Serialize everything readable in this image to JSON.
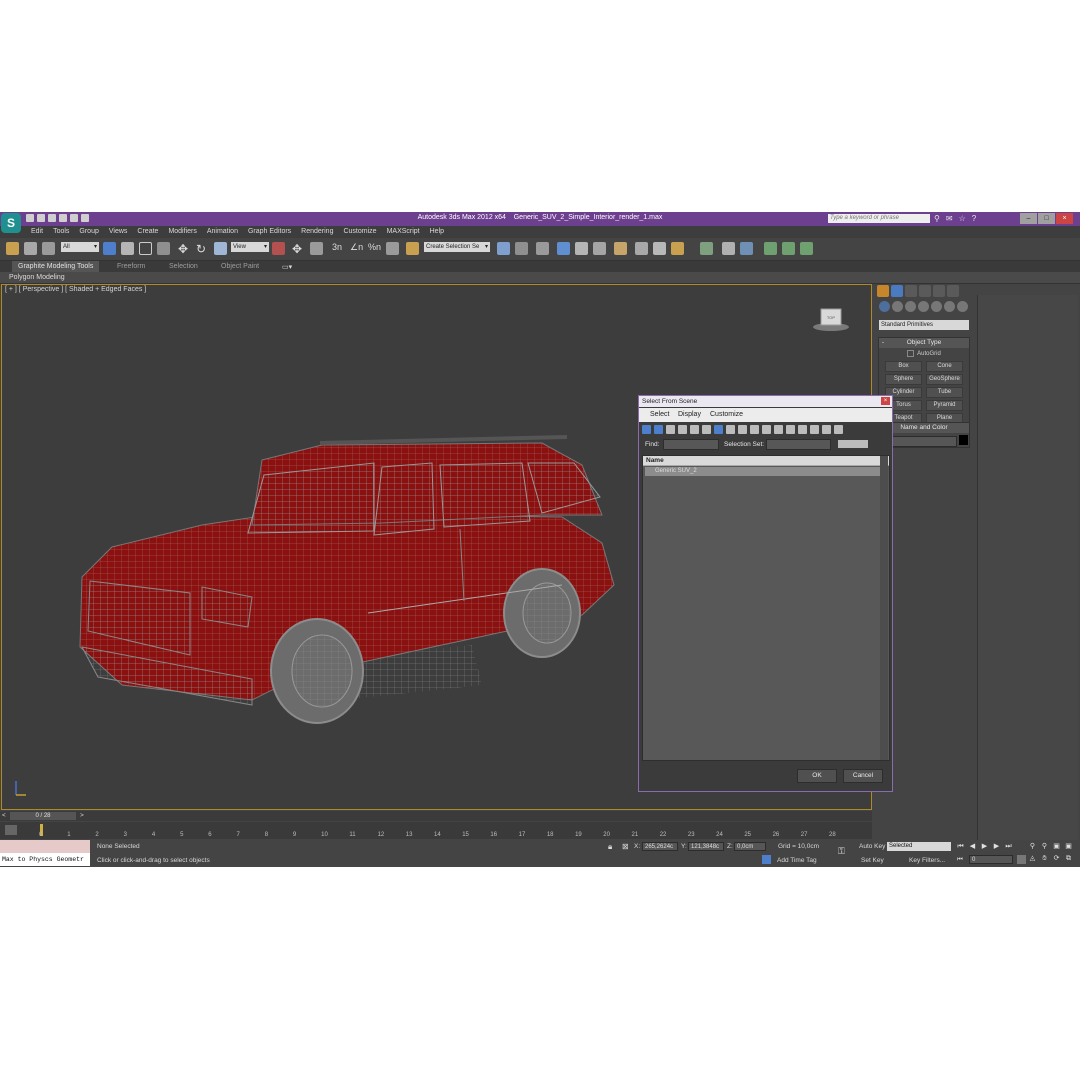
{
  "window": {
    "app_title": "Autodesk 3ds Max  2012 x64",
    "file_title": "Generic_SUV_2_Simple_Interior_render_1.max",
    "search_placeholder": "Type a keyword or phrase",
    "title_bar_color": "#6d3f8f"
  },
  "menu": [
    "Edit",
    "Tools",
    "Group",
    "Views",
    "Create",
    "Modifiers",
    "Animation",
    "Graph Editors",
    "Rendering",
    "Customize",
    "MAXScript",
    "Help"
  ],
  "toolbar": {
    "selection_filter": "All",
    "ref_coord": "View",
    "named_selection": "Create Selection Se"
  },
  "ribbon": {
    "tabs": [
      "Graphite Modeling Tools",
      "Freeform",
      "Selection",
      "Object Paint"
    ],
    "panel": "Polygon Modeling"
  },
  "viewport": {
    "label": "[ + ] [ Perspective ] [ Shaded + Edged Faces ]",
    "border_color": "#b08a25",
    "body_color": "#8b1111"
  },
  "command_panel": {
    "category": "Standard Primitives",
    "object_type_title": "Object Type",
    "autogrid": "AutoGrid",
    "buttons": [
      "Box",
      "Cone",
      "Sphere",
      "GeoSphere",
      "Cylinder",
      "Tube",
      "Torus",
      "Pyramid",
      "Teapot",
      "Plane"
    ],
    "name_color_title": "Name and Color"
  },
  "dialog": {
    "title": "Select From Scene",
    "menu": [
      "Select",
      "Display",
      "Customize"
    ],
    "find_label": "Find:",
    "selection_set_label": "Selection Set:",
    "column_header": "Name",
    "items": [
      "Generic SUV_2"
    ],
    "ok_label": "OK",
    "cancel_label": "Cancel",
    "border_color": "#8a6bb0"
  },
  "timeline": {
    "frame_display": "0 / 28",
    "prev": "<",
    "next": ">",
    "ticks": [
      "0",
      "1",
      "2",
      "3",
      "4",
      "5",
      "6",
      "7",
      "8",
      "9",
      "10",
      "11",
      "12",
      "13",
      "14",
      "15",
      "16",
      "17",
      "18",
      "19",
      "20",
      "21",
      "22",
      "23",
      "24",
      "25",
      "26",
      "27",
      "28"
    ]
  },
  "status": {
    "maxscript_listener": "Max to Physcs Geometr",
    "selection_status": "None Selected",
    "prompt": "Click or click-and-drag to select objects",
    "x_label": "X:",
    "x_value": "265,2624c",
    "y_label": "Y:",
    "y_value": "121,3848c",
    "z_label": "Z:",
    "z_value": "0,0cm",
    "grid": "Grid = 10,0cm",
    "add_time_tag": "Add Time Tag",
    "auto_key": "Auto Key",
    "auto_key_mode": "Selected",
    "set_key": "Set Key",
    "key_filters": "Key Filters...",
    "current_frame": "0"
  }
}
